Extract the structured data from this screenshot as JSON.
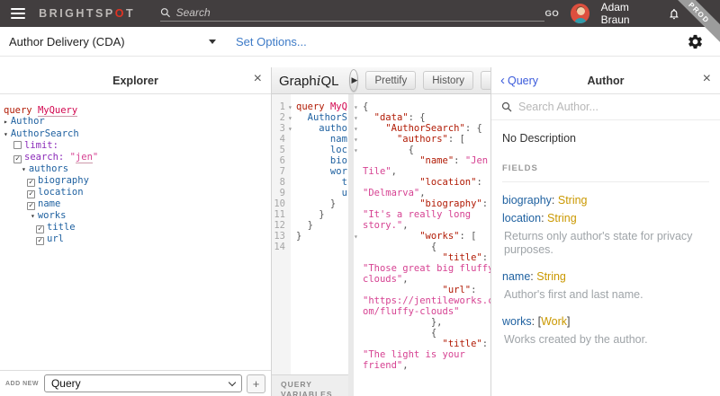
{
  "topbar": {
    "logo_pre": "BRIGHTSP",
    "logo_o": "O",
    "logo_post": "T",
    "search_placeholder": "Search",
    "go_label": "GO",
    "user_name": "Adam Braun",
    "ribbon": "PROD"
  },
  "toolbar": {
    "endpoint_label": "Author Delivery (CDA)",
    "set_options_label": "Set Options..."
  },
  "explorer": {
    "title": "Explorer",
    "close_label": "×",
    "tree": [
      {
        "type": "op",
        "keyword": "query ",
        "name": "MyQuery",
        "pad": 4
      },
      {
        "type": "node",
        "arrow": "right",
        "label": "Author",
        "pad": 4
      },
      {
        "type": "node",
        "arrow": "down",
        "label": "AuthorSearch",
        "pad": 4
      },
      {
        "type": "arg",
        "checked": false,
        "name": "limit:",
        "value": "",
        "pad": 15
      },
      {
        "type": "arg",
        "checked": true,
        "name": "search:",
        "value": "jen",
        "pad": 15
      },
      {
        "type": "node",
        "arrow": "down",
        "label": "authors",
        "pad": 24
      },
      {
        "type": "leaf",
        "checked": true,
        "label": "biography",
        "pad": 30
      },
      {
        "type": "leaf",
        "checked": true,
        "label": "location",
        "pad": 30
      },
      {
        "type": "leaf",
        "checked": true,
        "label": "name",
        "pad": 30
      },
      {
        "type": "node",
        "arrow": "down",
        "label": "works",
        "pad": 34
      },
      {
        "type": "leaf",
        "checked": true,
        "label": "title",
        "pad": 40
      },
      {
        "type": "leaf",
        "checked": true,
        "label": "url",
        "pad": 40
      }
    ],
    "add_new_label": "ADD NEW",
    "add_select_value": "Query",
    "add_button_label": "+"
  },
  "graphiql": {
    "logo": {
      "pre": "Graph",
      "i": "i",
      "post": "QL"
    },
    "play_icon": "▶",
    "buttons": [
      "Prettify",
      "History"
    ],
    "editor": {
      "lines": [
        {
          "n": "1",
          "fold": true,
          "parts": [
            [
              "query ",
              "kw"
            ],
            [
              "MyQ",
              "name"
            ]
          ]
        },
        {
          "n": "2",
          "fold": true,
          "parts": [
            [
              "  AuthorS",
              "field"
            ]
          ]
        },
        {
          "n": "3",
          "fold": true,
          "parts": [
            [
              "    autho",
              "field"
            ]
          ]
        },
        {
          "n": "4",
          "parts": [
            [
              "      nam",
              "field"
            ]
          ]
        },
        {
          "n": "5",
          "parts": [
            [
              "      loc",
              "field"
            ]
          ]
        },
        {
          "n": "6",
          "parts": [
            [
              "      bio",
              "field"
            ]
          ]
        },
        {
          "n": "7",
          "parts": [
            [
              "      wor",
              "field"
            ]
          ]
        },
        {
          "n": "8",
          "parts": [
            [
              "        t",
              "field"
            ]
          ]
        },
        {
          "n": "9",
          "parts": [
            [
              "        u",
              "field"
            ]
          ]
        },
        {
          "n": "10",
          "parts": [
            [
              "      }",
              "punct"
            ]
          ]
        },
        {
          "n": "11",
          "parts": [
            [
              "    }",
              "punct"
            ]
          ]
        },
        {
          "n": "12",
          "parts": [
            [
              "  }",
              "punct"
            ]
          ]
        },
        {
          "n": "13",
          "parts": [
            [
              "}",
              "punct"
            ]
          ]
        },
        {
          "n": "14",
          "parts": []
        }
      ],
      "variables_label": "QUERY VARIABLES"
    },
    "response": {
      "lines": [
        {
          "fold": true,
          "parts": [
            [
              "{",
              "punct"
            ]
          ]
        },
        {
          "fold": true,
          "parts": [
            [
              "  ",
              "punct"
            ],
            [
              "\"data\"",
              "key"
            ],
            [
              ": {",
              "punct"
            ]
          ]
        },
        {
          "fold": true,
          "parts": [
            [
              "    ",
              "punct"
            ],
            [
              "\"AuthorSearch\"",
              "key"
            ],
            [
              ": {",
              "punct"
            ]
          ]
        },
        {
          "fold": true,
          "parts": [
            [
              "      ",
              "punct"
            ],
            [
              "\"authors\"",
              "key"
            ],
            [
              ": [",
              "punct"
            ]
          ]
        },
        {
          "fold": true,
          "parts": [
            [
              "        {",
              "punct"
            ]
          ]
        },
        {
          "parts": [
            [
              "          ",
              "punct"
            ],
            [
              "\"name\"",
              "key"
            ],
            [
              ": ",
              "punct"
            ],
            [
              "\"Jen",
              "val"
            ]
          ]
        },
        {
          "parts": [
            [
              "Tile\"",
              "val"
            ],
            [
              ",",
              "punct"
            ]
          ]
        },
        {
          "parts": [
            [
              "          ",
              "punct"
            ],
            [
              "\"location\"",
              "key"
            ],
            [
              ":",
              "punct"
            ]
          ]
        },
        {
          "parts": [
            [
              "\"Delmarva\"",
              "val"
            ],
            [
              ",",
              "punct"
            ]
          ]
        },
        {
          "parts": [
            [
              "          ",
              "punct"
            ],
            [
              "\"biography\"",
              "key"
            ],
            [
              ":",
              "punct"
            ]
          ]
        },
        {
          "parts": [
            [
              "\"It's a really long",
              "val"
            ]
          ]
        },
        {
          "parts": [
            [
              "story.\"",
              "val"
            ],
            [
              ",",
              "punct"
            ]
          ]
        },
        {
          "fold": true,
          "parts": [
            [
              "          ",
              "punct"
            ],
            [
              "\"works\"",
              "key"
            ],
            [
              ": [",
              "punct"
            ]
          ]
        },
        {
          "parts": [
            [
              "            {",
              "punct"
            ]
          ]
        },
        {
          "parts": [
            [
              "              ",
              "punct"
            ],
            [
              "\"title\"",
              "key"
            ],
            [
              ":",
              "punct"
            ]
          ]
        },
        {
          "parts": [
            [
              "\"Those great big fluffy",
              "val"
            ]
          ]
        },
        {
          "parts": [
            [
              "clouds\"",
              "val"
            ],
            [
              ",",
              "punct"
            ]
          ]
        },
        {
          "parts": [
            [
              "              ",
              "punct"
            ],
            [
              "\"url\"",
              "key"
            ],
            [
              ":",
              "punct"
            ]
          ]
        },
        {
          "parts": [
            [
              "\"https://jentileworks.c",
              "val"
            ]
          ]
        },
        {
          "parts": [
            [
              "om/fluffy-clouds\"",
              "val"
            ]
          ]
        },
        {
          "parts": [
            [
              "            },",
              "punct"
            ]
          ]
        },
        {
          "parts": [
            [
              "            {",
              "punct"
            ]
          ]
        },
        {
          "parts": [
            [
              "              ",
              "punct"
            ],
            [
              "\"title\"",
              "key"
            ],
            [
              ":",
              "punct"
            ]
          ]
        },
        {
          "parts": [
            [
              "\"The light is your",
              "val"
            ]
          ]
        },
        {
          "parts": [
            [
              "friend\"",
              "val"
            ],
            [
              ",",
              "punct"
            ]
          ]
        }
      ]
    }
  },
  "docs": {
    "back_label": "Query",
    "back_chevron": "‹",
    "title": "Author",
    "close_label": "×",
    "search_placeholder": "Search Author...",
    "no_description": "No Description",
    "fields_label": "FIELDS",
    "fields": [
      {
        "name": "biography",
        "type": "String",
        "desc": ""
      },
      {
        "name": "location",
        "type": "String",
        "desc": "Returns only author's state for privacy purposes."
      },
      {
        "name": "name",
        "type": "String",
        "desc": "Author's first and last name."
      },
      {
        "name": "works",
        "type": "[Work]",
        "desc": "Works created by the author."
      }
    ]
  },
  "colors": {
    "brand_red": "#E03323",
    "field_blue": "#1F61A0",
    "type_orange": "#CA9800",
    "key_red": "#B11A04",
    "string_pink": "#D64292",
    "arg_purple": "#8B2BB9",
    "link_blue": "#3B5BDB"
  }
}
